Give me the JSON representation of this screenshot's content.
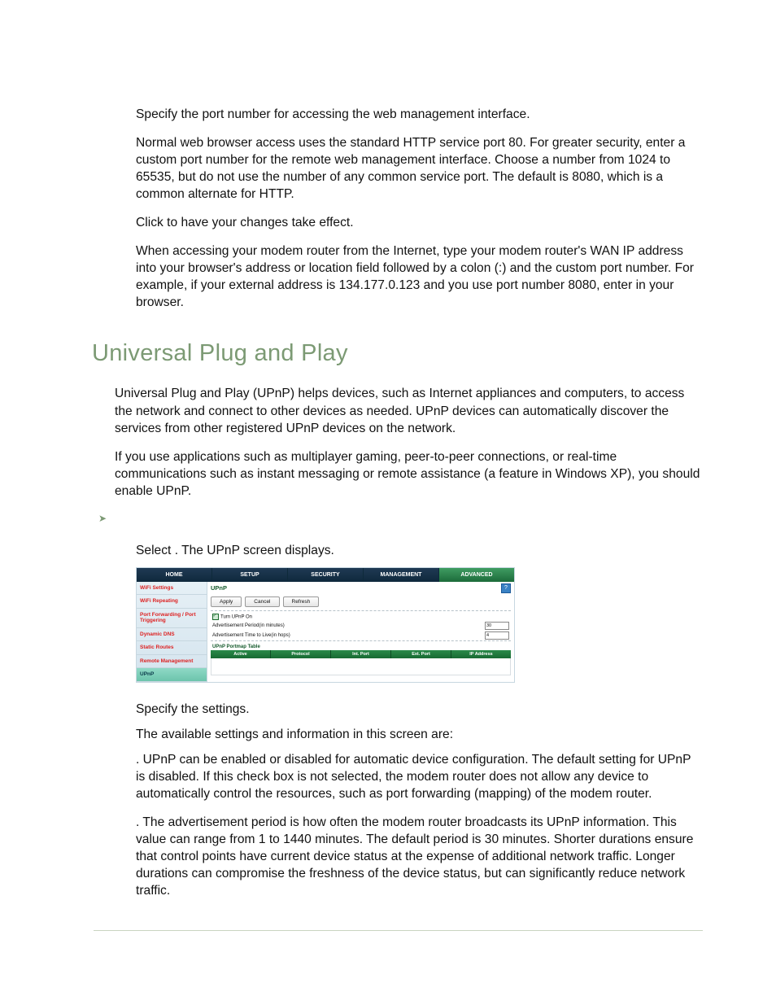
{
  "doc": {
    "port_spec": "Specify the port number for accessing the web management interface.",
    "port_info": "Normal web browser access uses the standard HTTP service port 80. For greater security, enter a custom port number for the remote web management interface. Choose a number from 1024 to 65535, but do not use the number of any common service port. The default is 8080, which is a common alternate for HTTP.",
    "click_pre": "Click ",
    "click_post": " to have your changes take effect.",
    "wan_info_pre": "When accessing your modem router from the Internet, type your modem router's WAN IP address into your browser's address or location field followed by a colon (:) and the custom port number. For example, if your external address is 134.177.0.123 and you use port number 8080, enter ",
    "wan_info_post": " in your browser.",
    "section": "Universal Plug and Play",
    "intro1": "Universal Plug and Play (UPnP) helps devices, such as Internet appliances and computers, to access the network and connect to other devices as needed. UPnP devices can automatically discover the services from other registered UPnP devices on the network.",
    "intro2": "If you use applications such as multiplayer gaming, peer-to-peer connections, or real-time communications such as instant messaging or remote assistance (a feature in Windows XP), you should enable UPnP.",
    "step_select_pre": "Select ",
    "step_select_post": ". The UPnP screen displays.",
    "step_specify": "Specify the settings.",
    "step_available": "The available settings and information in this screen are:",
    "turn_desc": ". UPnP can be enabled or disabled for automatic device configuration. The default setting for UPnP is disabled. If this check box is not selected, the modem router does not allow any device to automatically control the resources, such as port forwarding (mapping) of the modem router.",
    "adv_desc": ". The advertisement period is how often the modem router broadcasts its UPnP information. This value can range from 1 to 1440 minutes. The default period is 30 minutes. Shorter durations ensure that control points have current device status at the expense of additional network traffic. Longer durations can compromise the freshness of the device status, but can significantly reduce network traffic."
  },
  "ui": {
    "tabs": [
      "HOME",
      "SETUP",
      "SECURITY",
      "MANAGEMENT",
      "ADVANCED"
    ],
    "active_tab": 4,
    "sidebar": [
      "WiFi Settings",
      "WiFi Repeating",
      "Port Forwarding / Port Triggering",
      "Dynamic DNS",
      "Static Routes",
      "Remote Management",
      "UPnP"
    ],
    "active_side": 6,
    "title": "UPnP",
    "buttons": {
      "apply": "Apply",
      "cancel": "Cancel",
      "refresh": "Refresh"
    },
    "help": "?",
    "checkbox_label": "Turn UPnP On",
    "period_label": "Advertisement Period(in minutes)",
    "ttl_label": "Advertisement Time to Live(in hops)",
    "period_value": "30",
    "ttl_value": "4",
    "portmap_title": "UPnP Portmap Table",
    "port_headers": [
      "Active",
      "Protocol",
      "Int. Port",
      "Ext. Port",
      "IP Address"
    ]
  }
}
